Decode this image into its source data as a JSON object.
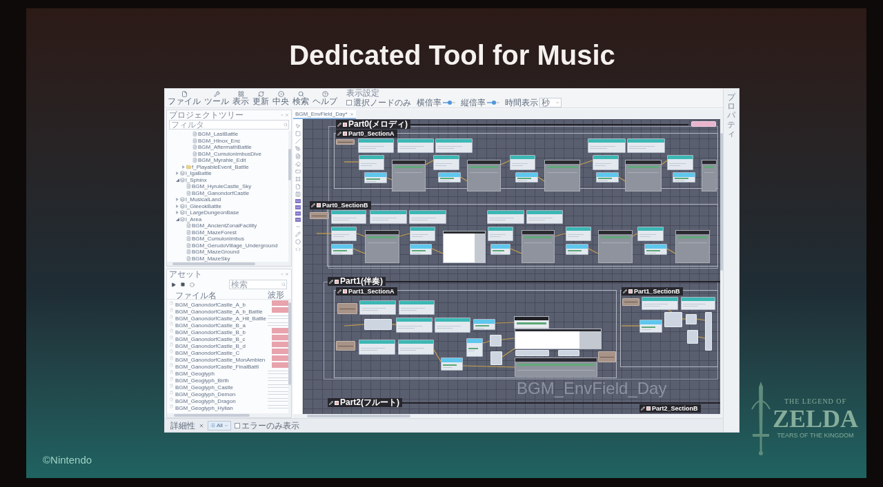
{
  "slide": {
    "title": "Dedicated Tool for Music",
    "copyright": "©Nintendo",
    "logo": {
      "top": "THE LEGEND OF",
      "main": "ZELDA",
      "bottom": "TEARS OF THE KINGDOM"
    }
  },
  "toolbar": {
    "buttons": [
      {
        "label": "ファイル"
      },
      {
        "label": "ツール"
      },
      {
        "label": "表示"
      },
      {
        "label": "更新"
      },
      {
        "label": "中央"
      },
      {
        "label": "検索"
      },
      {
        "label": "ヘルプ"
      }
    ],
    "display": {
      "title": "表示設定",
      "selected_only": {
        "label": "選択ノードのみ",
        "checked": false
      },
      "sliders": [
        {
          "label": "横倍率",
          "level": 0.6
        },
        {
          "label": "縦倍率",
          "level": 0.6
        }
      ],
      "time": {
        "label": "時間表示",
        "value": "秒"
      }
    }
  },
  "project_tree": {
    "title": "プロジェクトツリー",
    "search": {
      "placeholder": "フィルタ"
    },
    "items": [
      {
        "children": [
          {
            "children": [
              {
                "label": "BGM_LastBattle",
                "kind": "file"
              },
              {
                "label": "BGM_Hinox_Enc",
                "kind": "file"
              },
              {
                "label": "BGM_AftermathBattle",
                "kind": "file"
              },
              {
                "label": "BGM_CumulonimbusDive",
                "kind": "file"
              },
              {
                "label": "BGM_Myrahle_Edit",
                "kind": "file"
              }
            ]
          },
          {
            "label": "f_PlayableEvent_Battle",
            "kind": "folder",
            "expanded": false
          }
        ]
      },
      {
        "label": "l_IgaBattle",
        "kind": "group",
        "expanded": false
      },
      {
        "label": "l_Sphinx",
        "kind": "group",
        "expanded": true,
        "children": [
          {
            "label": "BGM_HyruleCastle_Sky",
            "kind": "file"
          },
          {
            "label": "BGM_GanondorfCastle",
            "kind": "file"
          }
        ]
      },
      {
        "label": "l_MusicalLand",
        "kind": "group",
        "expanded": false
      },
      {
        "label": "l_GleeokBattle",
        "kind": "group",
        "expanded": false
      },
      {
        "label": "l_LargeDungeonBase",
        "kind": "group",
        "expanded": false
      },
      {
        "label": "l_Area",
        "kind": "group",
        "expanded": true,
        "children": [
          {
            "label": "BGM_AncientZonaiFacility",
            "kind": "file"
          },
          {
            "label": "BGM_MazeForest",
            "kind": "file"
          },
          {
            "label": "BGM_Cumulonimbus",
            "kind": "file"
          },
          {
            "label": "BGM_GerudoVillage_Underground",
            "kind": "file"
          },
          {
            "label": "BGM_MazeGround",
            "kind": "file"
          },
          {
            "label": "BGM_MazeSky",
            "kind": "file"
          }
        ]
      }
    ]
  },
  "assets": {
    "title": "アセット",
    "search": {
      "placeholder": "検索"
    },
    "columns": [
      "ファイル名",
      "波形"
    ],
    "rows": [
      {
        "name": "BGM_GanondorfCastle_A_b",
        "waveform": true
      },
      {
        "name": "BGM_GanondorfCastle_A_b_Battle",
        "waveform": true
      },
      {
        "name": "BGM_GanondorfCastle_A_Hit_Battle",
        "waveform": false
      },
      {
        "name": "BGM_GanondorfCastle_B_a",
        "waveform": false
      },
      {
        "name": "BGM_GanondorfCastle_B_b",
        "waveform": true
      },
      {
        "name": "BGM_GanondorfCastle_B_c",
        "waveform": true
      },
      {
        "name": "BGM_GanondorfCastle_B_d",
        "waveform": true
      },
      {
        "name": "BGM_GanondorfCastle_C",
        "waveform": true
      },
      {
        "name": "BGM_GanondorfCastle_MonAmbien",
        "waveform": true
      },
      {
        "name": "BGM_GanondorfCastle_FinalBattl",
        "waveform": true
      },
      {
        "name": "BGM_Geoglyph",
        "waveform": false
      },
      {
        "name": "BGM_Geoglyph_Birth",
        "waveform": false
      },
      {
        "name": "BGM_Geoglyph_Castle",
        "waveform": false
      },
      {
        "name": "BGM_Geoglyph_Demon",
        "waveform": false
      },
      {
        "name": "BGM_Geoglyph_Dragon",
        "waveform": false
      },
      {
        "name": "BGM_Geoglyph_Hylian",
        "waveform": false
      }
    ]
  },
  "status_bar": {
    "label": "詳細性",
    "filter": {
      "value": "All"
    },
    "errors_only": {
      "label": "エラーのみ表示",
      "checked": false
    }
  },
  "editor": {
    "tab": {
      "label": "BGM_EnvField_Day*"
    },
    "canvas_title": "BGM_EnvField_Day",
    "parts": [
      {
        "label": "Part0(メロディ)",
        "sections": [
          {
            "label": "Part0_SectionA"
          },
          {
            "label": "Part0_SectionB"
          }
        ]
      },
      {
        "label": "Part1(伴奏)",
        "sections": [
          {
            "label": "Part1_SectionA"
          },
          {
            "label": "Part1_SectionB"
          }
        ]
      },
      {
        "label": "Part2(フルート)",
        "sections": [
          {
            "label": "Part2_SectionB"
          }
        ]
      }
    ]
  },
  "properties_panel": {
    "title": "プロパティ"
  }
}
